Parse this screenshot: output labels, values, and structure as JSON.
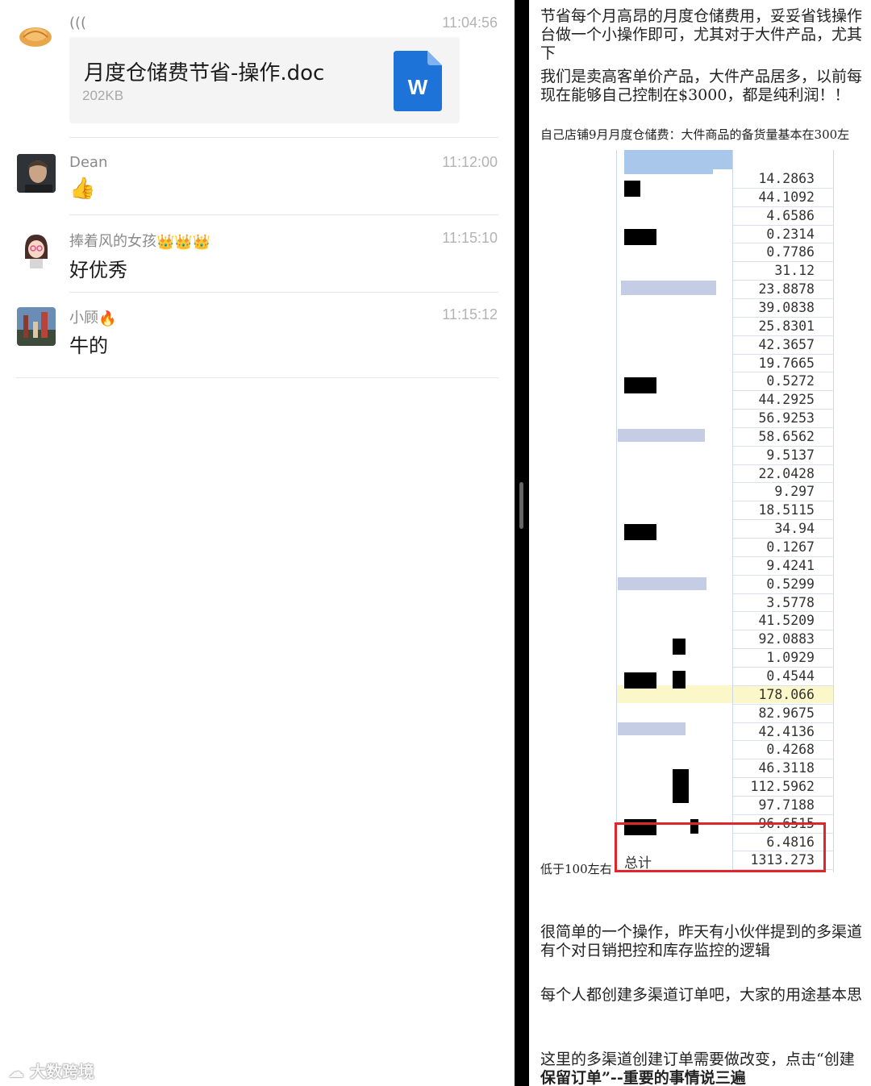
{
  "chat": {
    "messages": [
      {
        "sender": "(((",
        "time": "11:04:56",
        "file": {
          "name": "月度仓储费节省-操作.doc",
          "size": "202KB",
          "icon_letter": "W"
        }
      },
      {
        "sender": "Dean",
        "time": "11:12:00",
        "emoji": "👍"
      },
      {
        "sender": "捧着风的女孩",
        "sender_emoji": "👑👑👑",
        "time": "11:15:10",
        "text": "好优秀"
      },
      {
        "sender": "小顾",
        "sender_emoji": "🔥",
        "time": "11:15:12",
        "text": "牛的"
      }
    ],
    "watermark": "大数跨境"
  },
  "doc": {
    "para1": [
      "节省每个月高昂的月度仓储费用，妥妥省钱操作",
      "台做一个小操作即可，尤其对于大件产品，尤其",
      "下"
    ],
    "para2": [
      "我们是卖高客单价产品，大件产品居多，以前每",
      "现在能够自己控制在$3000，都是纯利润！！"
    ],
    "caption": "自己店铺9月月度仓储费：大件商品的备货量基本在300左",
    "table": {
      "values": [
        "14.2863",
        "44.1092",
        "4.6586",
        "0.2314",
        "0.7786",
        "31.12",
        "23.8878",
        "39.0838",
        "25.8301",
        "42.3657",
        "19.7665",
        "0.5272",
        "44.2925",
        "56.9253",
        "58.6562",
        "9.5137",
        "22.0428",
        "9.297",
        "18.5115",
        "34.94",
        "0.1267",
        "9.4241",
        "0.5299",
        "3.5778",
        "41.5209",
        "92.0883",
        "1.0929",
        "0.4544",
        "178.066",
        "82.9675",
        "42.4136",
        "0.4268",
        "46.3118",
        "112.5962",
        "97.7188",
        "96.6515",
        "6.4816",
        "1313.273"
      ],
      "total_label": "总计",
      "highlight_row_value": "178.066"
    },
    "low_note": "低于100左右",
    "para3": [
      "很简单的一个操作，昨天有小伙伴提到的多渠道",
      "有个对日销把控和库存监控的逻辑"
    ],
    "para4": [
      "每个人都创建多渠道订单吧，大家的用途基本思"
    ],
    "para5": [
      "这里的多渠道创建订单需要做改变，点击“创建",
      "保留订单”--重要的事情说三遍"
    ]
  },
  "colors": {
    "word_blue": "#1e73d8",
    "red_box": "#e0252b",
    "highlight": "#fbf7c8"
  }
}
